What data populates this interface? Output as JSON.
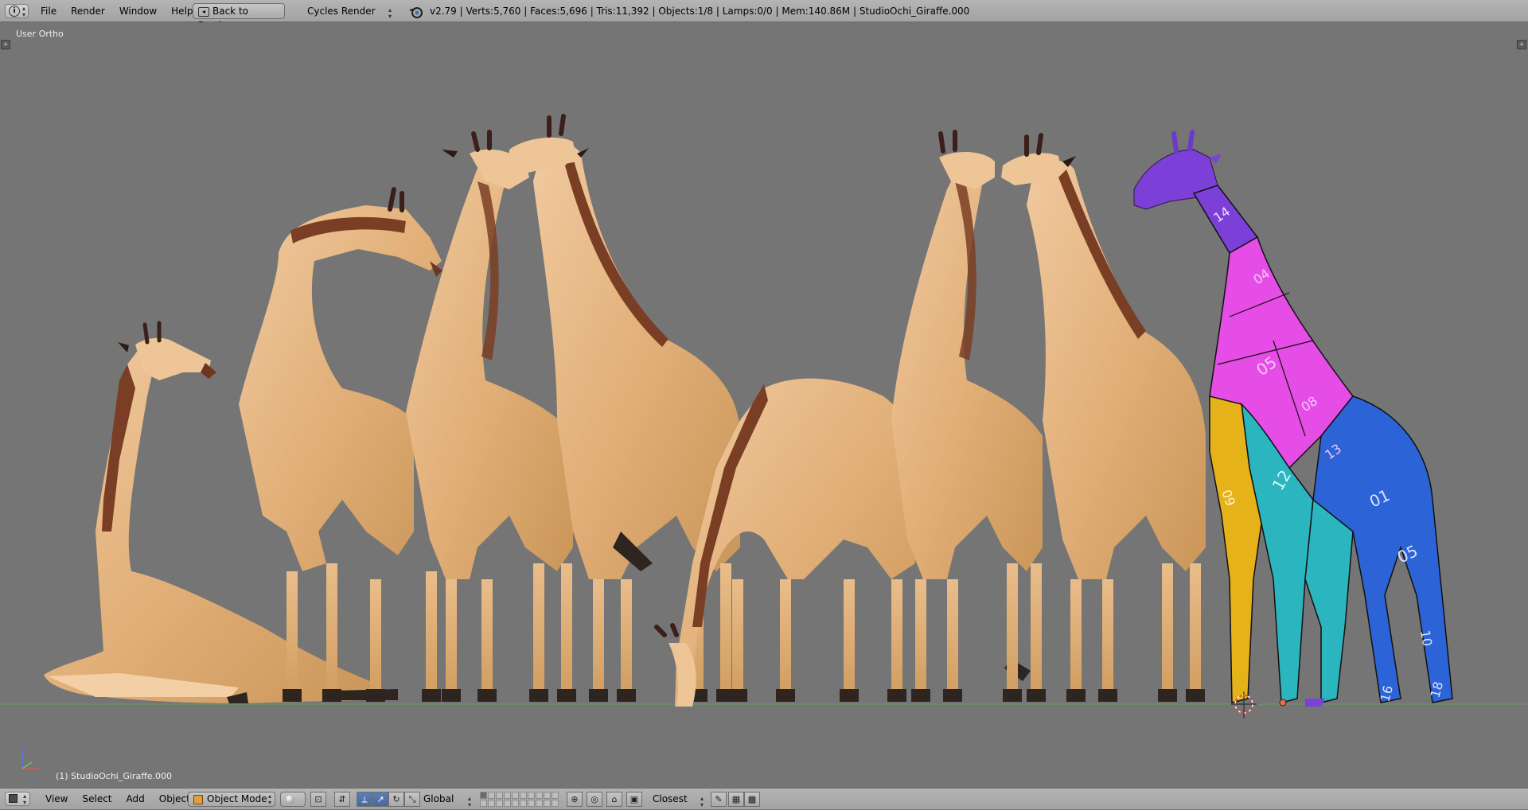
{
  "top_header": {
    "menu": [
      "File",
      "Render",
      "Window",
      "Help"
    ],
    "back_button": "Back to Previous",
    "render_engine": "Cycles Render",
    "stats": "v2.79 | Verts:5,760 | Faces:5,696 | Tris:11,392 | Objects:1/8 | Lamps:0/0 | Mem:140.86M | StudioOchi_Giraffe.000"
  },
  "viewport": {
    "view_name": "User Ortho",
    "object_name": "(1) StudioOchi_Giraffe.000",
    "uv_labels": [
      "14",
      "04",
      "05",
      "08",
      "13",
      "12",
      "09",
      "01",
      "05",
      "10",
      "16",
      "18"
    ]
  },
  "bottom_header": {
    "menu": [
      "View",
      "Select",
      "Add",
      "Object"
    ],
    "mode": "Object Mode",
    "orientation": "Global",
    "snap_target": "Closest"
  },
  "colors": {
    "viewport_bg": "#757575",
    "giraffe_body": "#e3b57a",
    "giraffe_mane": "#7a3e24",
    "uv_purple": "#7c3fd8",
    "uv_magenta": "#e64ce6",
    "uv_cyan": "#2bb5bf",
    "uv_yellow": "#e5b21a",
    "uv_blue": "#2c63d6",
    "header_bg": "#a9a9a9"
  }
}
